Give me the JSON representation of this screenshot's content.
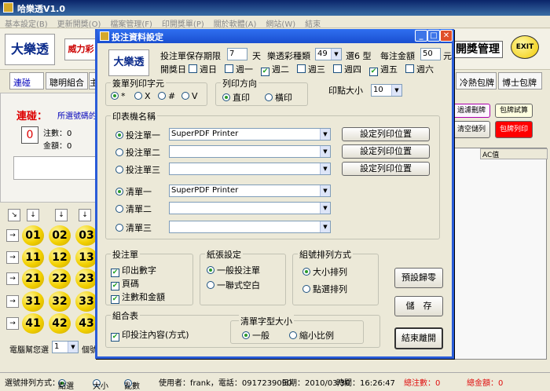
{
  "main": {
    "title": "哈樂透V1.0",
    "menu": [
      "基本設定(B)",
      "更新開獎(O)",
      "檔案管理(F)",
      "印開獎單(P)",
      "關於軟體(A)",
      "網站(W)",
      "結束"
    ],
    "logo_text": "大樂透",
    "logo_badge": "6/49",
    "logo2_text": "威力彩",
    "lottery_mgmt_label": "開獎管理",
    "exit_label": "EXIT",
    "tabs": [
      "連碰",
      "聰明組合",
      "主",
      "冷熱包牌",
      "博士包牌"
    ],
    "panel_title": "連碰：",
    "panel_desc": "所選號碼的主",
    "count_label": "注數：0",
    "amount_label": "金額：0",
    "zero_badge": "0",
    "balls": [
      "01",
      "02",
      "03",
      "11",
      "12",
      "13",
      "21",
      "22",
      "23",
      "31",
      "32",
      "33",
      "41",
      "42",
      "43"
    ],
    "computer_select_label": "電腦幫您選",
    "computer_select_value": "1",
    "group_label": "個號",
    "right_buttons": {
      "filter": "過濾刪牌",
      "trial": "包牌試算",
      "clear": "清空儲列",
      "print": "包牌列印"
    },
    "ac_header": "AC值"
  },
  "status": {
    "sort_label": "選號排列方式：",
    "sort_options": [
      "點選",
      "大小",
      "亂數"
    ],
    "sort_selected": 0,
    "user": "使用者：frank，電話：0917239090",
    "date": "日期：2010/03/30",
    "time": "時間：16:26:47",
    "total_count": "總注數：0",
    "total_amount": "總金額：0"
  },
  "dialog": {
    "title": "投注資料設定",
    "keep_label": "投注單保存期限",
    "keep_value": "7",
    "keep_unit": "天",
    "type_label": "樂透彩種類",
    "type_value": "49",
    "pick_label": "選6 型",
    "bet_label": "每注金額",
    "bet_value": "50",
    "bet_unit": "元",
    "draw_label": "開獎日",
    "weekdays": [
      "週日",
      "週一",
      "週二",
      "週三",
      "週四",
      "週五",
      "週六"
    ],
    "weekdays_checked": [
      false,
      false,
      true,
      false,
      false,
      true,
      false
    ],
    "ballot_char": {
      "title": "簽單列印字元",
      "options": [
        "*",
        "X",
        "#",
        "V"
      ],
      "selected": 0
    },
    "print_dir": {
      "title": "列印方向",
      "options": [
        "直印",
        "橫印"
      ],
      "selected": 0
    },
    "dot_size_label": "印點大小",
    "dot_size_value": "10",
    "printer": {
      "title": "印表機名稱",
      "rows": [
        {
          "label": "投注單一",
          "value": "SuperPDF Printer",
          "selected": true,
          "button": "設定列印位置"
        },
        {
          "label": "投注單二",
          "value": "",
          "selected": false,
          "button": "設定列印位置"
        },
        {
          "label": "投注單三",
          "value": "",
          "selected": false,
          "button": "設定列印位置"
        },
        {
          "label": "清單一",
          "value": "SuperPDF Printer",
          "selected": true
        },
        {
          "label": "清單二",
          "value": "",
          "selected": false
        },
        {
          "label": "清單三",
          "value": "",
          "selected": false
        }
      ]
    },
    "bet_sheet": {
      "title": "投注單",
      "items": [
        "印出數字",
        "頁碼",
        "注數和金額"
      ]
    },
    "paper": {
      "title": "紙張設定",
      "options": [
        "一般投注單",
        "一聯式空白"
      ],
      "selected": 0
    },
    "sort": {
      "title": "組號排列方式",
      "options": [
        "大小排列",
        "點選排列"
      ],
      "selected": 0
    },
    "combo": {
      "title": "組合表",
      "item": "印投注內容(方式)"
    },
    "font_size": {
      "title": "清單字型大小",
      "options": [
        "一般",
        "縮小比例"
      ],
      "selected": 0
    },
    "buttons": {
      "reset": "預設歸零",
      "save": "儲　存",
      "close": "結束離開"
    }
  },
  "colors": {
    "title_blue": "#2f6ff0",
    "ball_yellow": "#f2d000",
    "accent_red": "#e01010"
  }
}
